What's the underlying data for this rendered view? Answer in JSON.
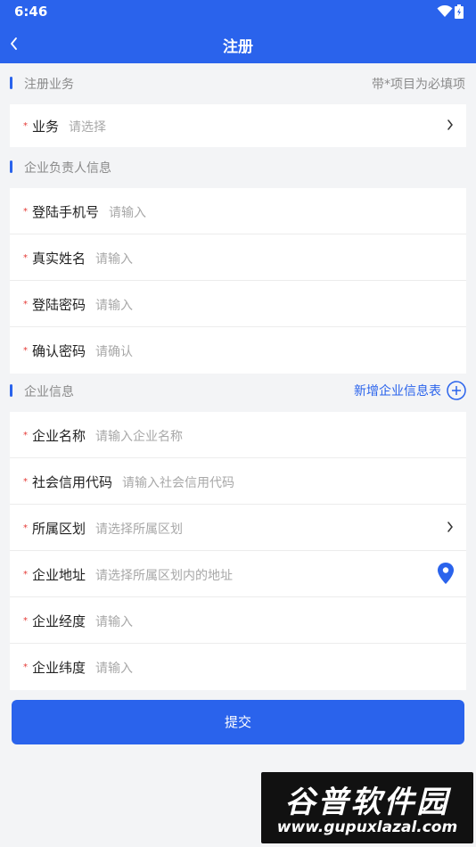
{
  "status": {
    "time": "6:46"
  },
  "nav": {
    "title": "注册"
  },
  "sec1": {
    "title": "注册业务",
    "hint": "带*项目为必填项"
  },
  "business": {
    "label": "业务",
    "placeholder": "请选择"
  },
  "sec2": {
    "title": "企业负责人信息"
  },
  "owner": [
    {
      "label": "登陆手机号",
      "placeholder": "请输入"
    },
    {
      "label": "真实姓名",
      "placeholder": "请输入"
    },
    {
      "label": "登陆密码",
      "placeholder": "请输入"
    },
    {
      "label": "确认密码",
      "placeholder": "请确认"
    }
  ],
  "sec3": {
    "title": "企业信息",
    "add_link": "新增企业信息表"
  },
  "company": [
    {
      "label": "企业名称",
      "placeholder": "请输入企业名称"
    },
    {
      "label": "社会信用代码",
      "placeholder": "请输入社会信用代码"
    },
    {
      "label": "所属区划",
      "placeholder": "请选择所属区划"
    },
    {
      "label": "企业地址",
      "placeholder": "请选择所属区划内的地址"
    },
    {
      "label": "企业经度",
      "placeholder": "请输入"
    },
    {
      "label": "企业纬度",
      "placeholder": "请输入"
    }
  ],
  "required_mark": "*",
  "submit_label": "提交",
  "watermark": {
    "title": "谷普软件园",
    "url": "www.gupuxlazal.com"
  },
  "colors": {
    "primary": "#2a63ec",
    "required": "#e53935",
    "placeholder": "#a8a8a8"
  },
  "icons": {
    "back": "chevron-left-icon",
    "arrow": "chevron-right-icon",
    "location": "location-pin-icon",
    "add": "plus-circle-icon"
  }
}
